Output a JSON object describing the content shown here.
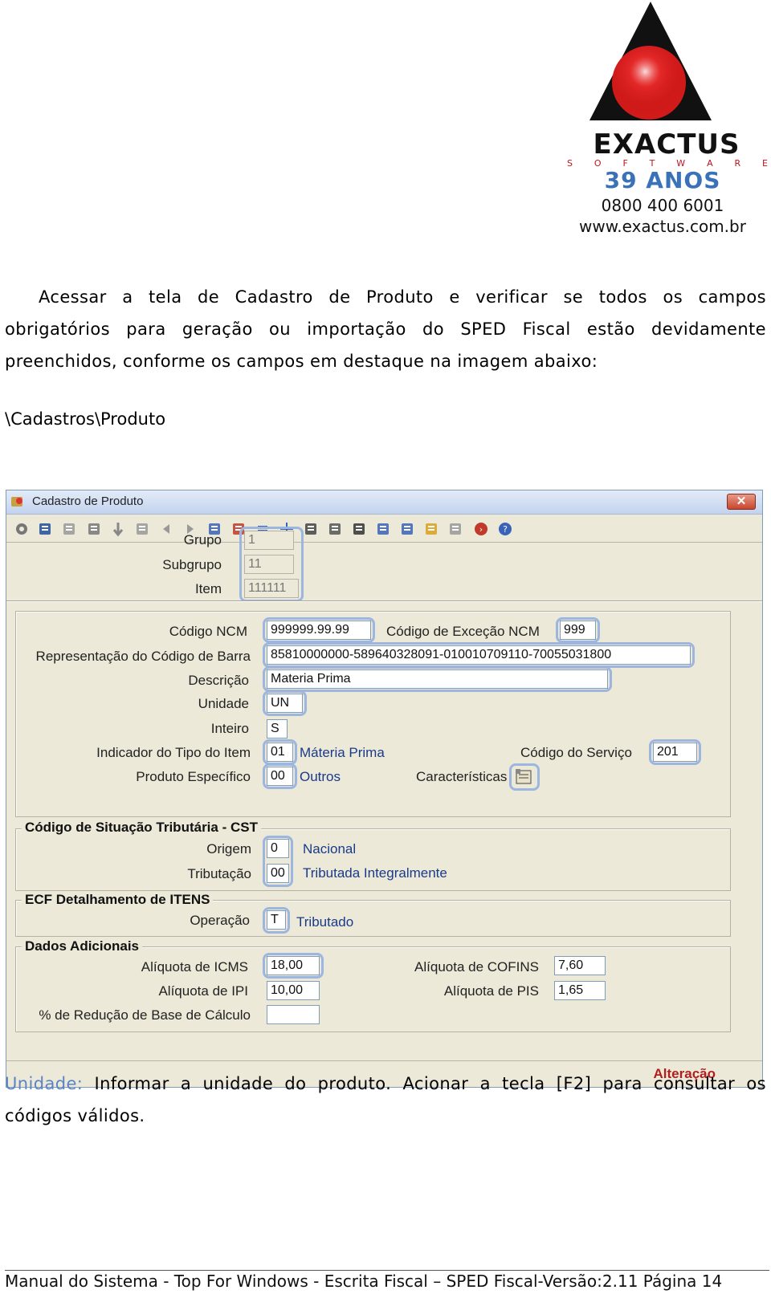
{
  "header": {
    "brand": "EXACTUS",
    "brand_sub": [
      "S",
      "O",
      "F",
      "T",
      "W",
      "A",
      "R",
      "E"
    ],
    "years": "39 ANOS",
    "phone": "0800 400 6001",
    "site": "www.exactus.com.br"
  },
  "intro": {
    "line1": "Acessar a tela de Cadastro de Produto e verificar se todos os campos",
    "line2": "obrigatórios para geração ou importação do SPED Fiscal estão devidamente",
    "line3": "preenchidos, conforme os campos em destaque na imagem abaixo:"
  },
  "path": "\\Cadastros\\Produto",
  "window": {
    "title": "Cadastro de Produto",
    "close_label": "✕",
    "top": {
      "grupo_label": "Grupo",
      "grupo_value": "1",
      "subgrupo_label": "Subgrupo",
      "subgrupo_value": "11",
      "item_label": "Item",
      "item_value": "111111"
    },
    "main": {
      "ncm_label": "Código NCM",
      "ncm_value": "999999.99.99",
      "exc_label": "Código de Exceção NCM",
      "exc_value": "999",
      "barra_label": "Representação do Código de Barra",
      "barra_value": "85810000000-589640328091-010010709110-70055031800",
      "desc_label": "Descrição",
      "desc_value": "Materia Prima",
      "unidade_label": "Unidade",
      "unidade_value": "UN",
      "inteiro_label": "Inteiro",
      "inteiro_value": "S",
      "tipo_label": "Indicador do Tipo do Item",
      "tipo_value": "01",
      "tipo_desc": "Máteria Prima",
      "servico_label": "Código do Serviço",
      "servico_value": "201",
      "especifico_label": "Produto Específico",
      "especifico_value": "00",
      "especifico_desc": "Outros",
      "caract_label": "Características"
    },
    "cst": {
      "title": "Código de Situação Tributária - CST",
      "origem_label": "Origem",
      "origem_value": "0",
      "origem_desc": "Nacional",
      "trib_label": "Tributação",
      "trib_value": "00",
      "trib_desc": "Tributada Integralmente"
    },
    "ecf": {
      "title": "ECF Detalhamento de ITENS",
      "op_label": "Operação",
      "op_value": "T",
      "op_desc": "Tributado"
    },
    "adicionais": {
      "title": "Dados Adicionais",
      "icms_label": "Alíquota de ICMS",
      "icms_value": "18,00",
      "ipi_label": "Alíquota de IPI",
      "ipi_value": "10,00",
      "reducao_label": "% de Redução de Base de Cálculo",
      "reducao_value": "",
      "cofins_label": "Alíquota de COFINS",
      "cofins_value": "7,60",
      "pis_label": "Alíquota de PIS",
      "pis_value": "1,65"
    },
    "status": "Alteração",
    "toolbar_icons": [
      "gear-icon",
      "save-icon",
      "edit-icon",
      "move-icon",
      "down-arrow-icon",
      "preview-icon",
      "prev-icon",
      "next-icon",
      "import-icon",
      "export-icon",
      "equals-icon",
      "cross-arrows-icon",
      "calculator-icon",
      "grid-icon",
      "filter-icon",
      "list-icon",
      "refresh-icon",
      "pen-icon",
      "document-icon",
      "exit-icon",
      "help-icon"
    ]
  },
  "unidade_note": {
    "label": "Unidade:",
    "text1": " Informar a unidade do produto. Acionar a tecla [F2] para consultar os",
    "text2": "códigos válidos."
  },
  "footer": "Manual do Sistema - Top For Windows - Escrita Fiscal – SPED Fiscal-Versão:2.11 Página 14",
  "colors": {
    "accent_blue": "#3a72b8",
    "status_red": "#b01e1e",
    "highlight": "#9cb6e0"
  }
}
